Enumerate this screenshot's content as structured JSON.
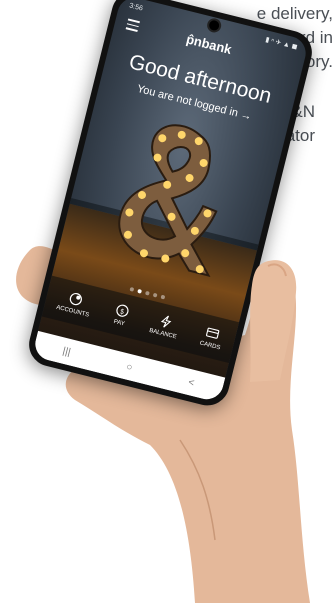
{
  "background_text": {
    "lines": [
      "e delivery,",
      "ward in",
      "egory.",
      "",
      "P&N",
      "ator"
    ]
  },
  "phone": {
    "status_time": "3:56",
    "status_icons": "▮ ⁿ ✈ ▲ ◼",
    "logo": "p̂nbank",
    "greeting": "Good afternoon",
    "login_text": "You are not logged in →",
    "carousel": {
      "count": 5,
      "active": 1
    },
    "nav": [
      {
        "label": "ACCOUNTS",
        "icon": "coins-icon"
      },
      {
        "label": "PAY",
        "icon": "dollar-circle-icon"
      },
      {
        "label": "BALANCE",
        "icon": "bolt-icon"
      },
      {
        "label": "CARDS",
        "icon": "card-icon"
      }
    ],
    "system_buttons": [
      "|||",
      "○",
      "<"
    ]
  },
  "colors": {
    "text_gray": "#4a4f55",
    "bulb": "#ffd66b",
    "amp_metal": "#8a6a4a"
  }
}
